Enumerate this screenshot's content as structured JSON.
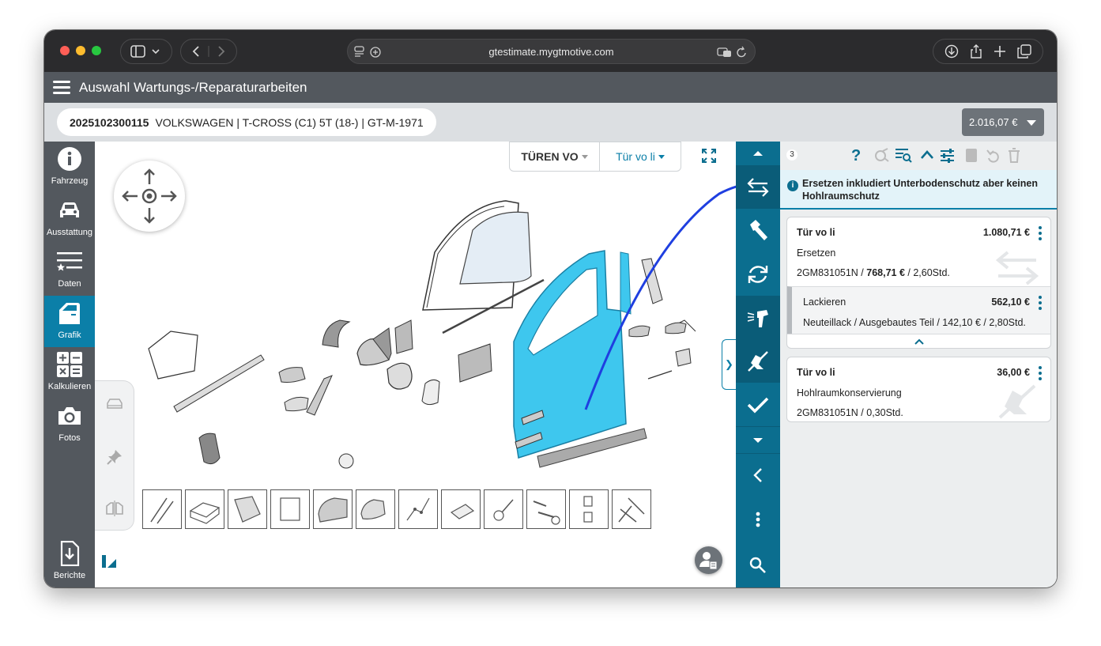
{
  "browser": {
    "url": "gtestimate.mygtmotive.com"
  },
  "app": {
    "title": "Auswahl Wartungs-/Reparaturarbeiten",
    "claim_number": "2025102300115",
    "vehicle": "VOLKSWAGEN | T-CROSS (C1) 5T (18-) | GT-M-1971",
    "total_price": "2.016,07 €"
  },
  "nav": {
    "items": [
      {
        "label": "Fahrzeug",
        "icon": "info-icon"
      },
      {
        "label": "Ausstattung",
        "icon": "car-icon"
      },
      {
        "label": "Daten",
        "icon": "list-star-icon"
      },
      {
        "label": "Grafik",
        "icon": "door-icon"
      },
      {
        "label": "Kalkulieren",
        "icon": "calculator-icon"
      },
      {
        "label": "Fotos",
        "icon": "camera-icon"
      },
      {
        "label": "Berichte",
        "icon": "download-document-icon"
      }
    ]
  },
  "graphic": {
    "group_select": "TÜREN VO",
    "part_select": "Tür vo li"
  },
  "panel": {
    "count": "3",
    "info_message": "Ersetzen inkludiert Unterbodenschutz aber keinen Hohlraumschutz",
    "cards": [
      {
        "title": "Tür vo li",
        "price": "1.080,71 €",
        "operation": "Ersetzen",
        "detail_prefix": "2GM831051N / ",
        "detail_bold": "768,71 €",
        "detail_suffix": " / 2,60Std.",
        "sub": {
          "title": "Lackieren",
          "price": "562,10 €",
          "detail": "Neuteillack / Ausgebautes Teil / 142,10 € / 2,80Std."
        }
      },
      {
        "title": "Tür vo li",
        "price": "36,00 €",
        "operation": "Hohlraumkonservierung",
        "detail": "2GM831051N / 0,30Std."
      }
    ]
  },
  "colors": {
    "accent": "#0b7fa8",
    "toolstrip": "#0b6e8f",
    "door_part": "#3ec7ee",
    "annotation_arrow": "#1f3fe0"
  }
}
